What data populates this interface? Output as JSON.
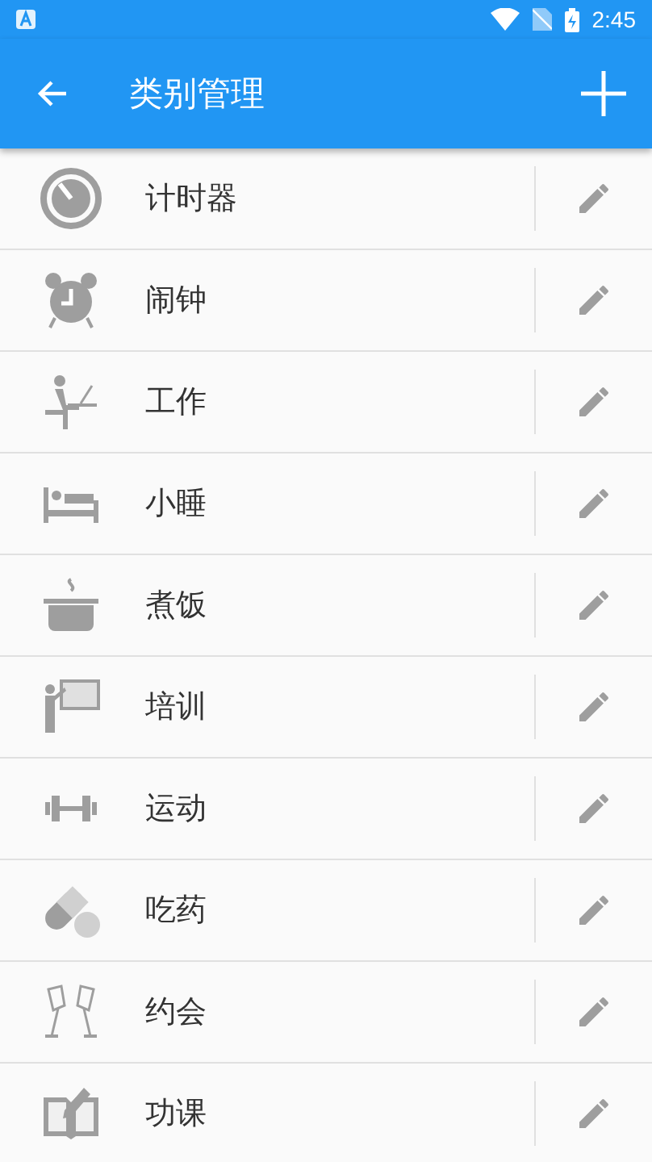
{
  "status_bar": {
    "time": "2:45"
  },
  "app_bar": {
    "title": "类别管理"
  },
  "categories": [
    {
      "name": "计时器"
    },
    {
      "name": "闹钟"
    },
    {
      "name": "工作"
    },
    {
      "name": "小睡"
    },
    {
      "name": "煮饭"
    },
    {
      "name": "培训"
    },
    {
      "name": "运动"
    },
    {
      "name": "吃药"
    },
    {
      "name": "约会"
    },
    {
      "name": "功课"
    }
  ]
}
